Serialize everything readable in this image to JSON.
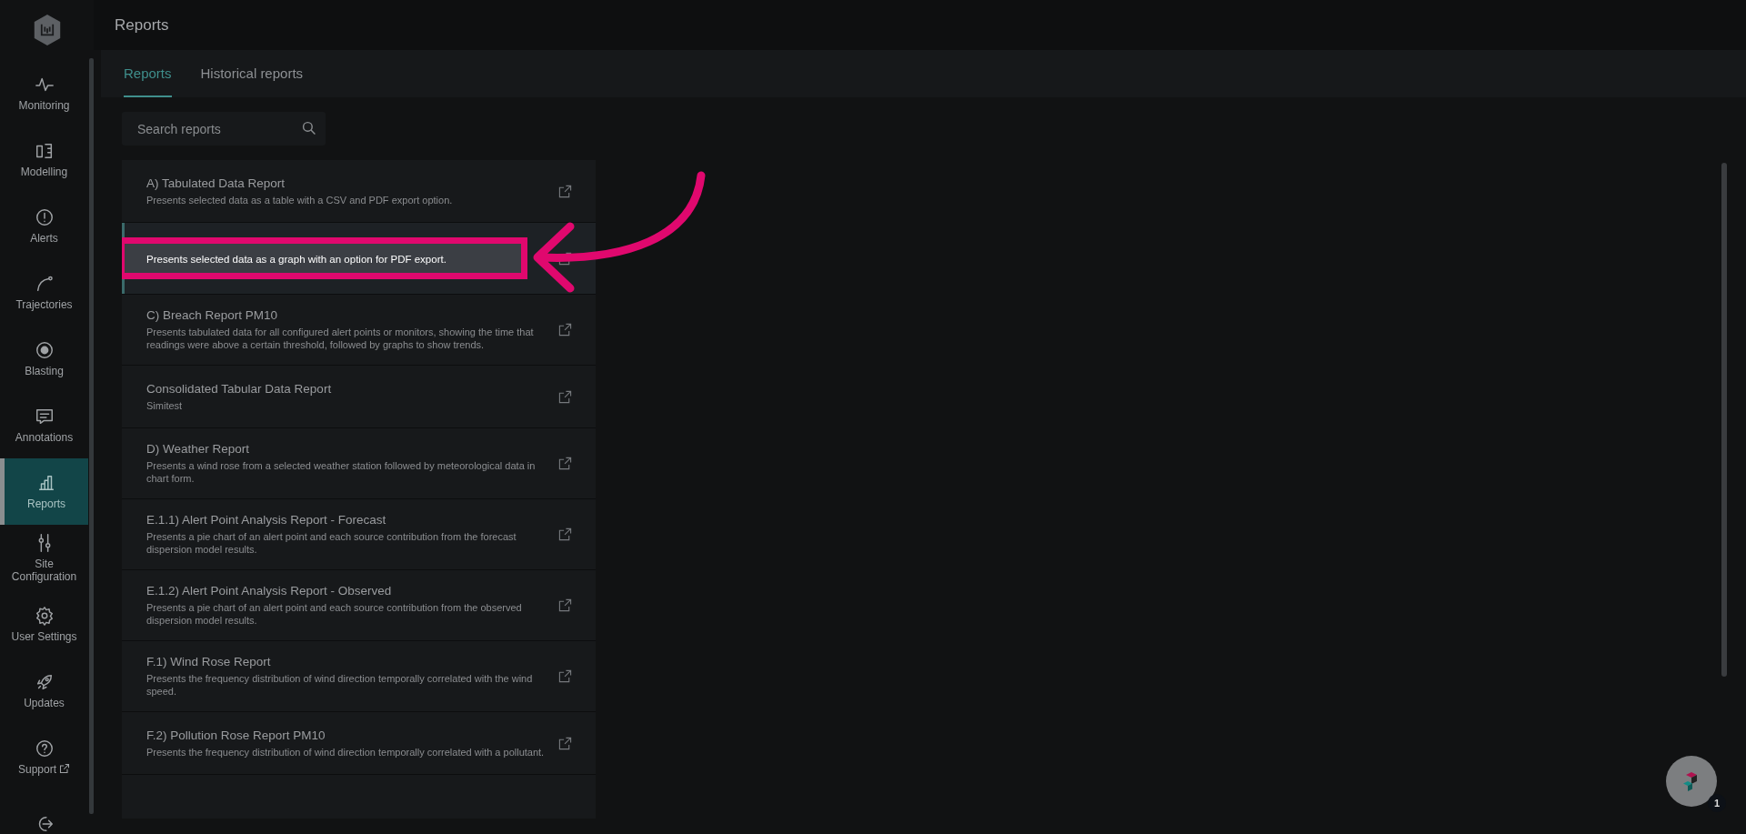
{
  "page": {
    "title": "Reports"
  },
  "sidebar": {
    "items": [
      {
        "label": "Monitoring",
        "external": false,
        "selected": false
      },
      {
        "label": "Modelling",
        "external": false,
        "selected": false
      },
      {
        "label": "Alerts",
        "external": false,
        "selected": false
      },
      {
        "label": "Trajectories",
        "external": false,
        "selected": false
      },
      {
        "label": "Blasting",
        "external": false,
        "selected": false
      },
      {
        "label": "Annotations",
        "external": false,
        "selected": false
      },
      {
        "label": "Reports",
        "external": false,
        "selected": true
      },
      {
        "label": "Site Configuration",
        "external": false,
        "selected": false
      },
      {
        "label": "User Settings",
        "external": false,
        "selected": false
      },
      {
        "label": "Updates",
        "external": false,
        "selected": false
      },
      {
        "label": "Support",
        "external": true,
        "selected": false
      },
      {
        "external": false,
        "selected": false
      }
    ]
  },
  "tabs": [
    {
      "label": "Reports",
      "selected": true
    },
    {
      "label": "Historical reports",
      "selected": false
    }
  ],
  "search": {
    "placeholder": "Search reports"
  },
  "reports": [
    {
      "title": "A) Tabulated Data Report",
      "description": "Presents selected data as a table with a CSV and PDF export option.",
      "selected": false,
      "highlighted": false
    },
    {
      "description": "Presents selected data as a graph with an option for PDF export.",
      "selected": true,
      "highlighted": true
    },
    {
      "title": "C) Breach Report PM10",
      "description": "Presents tabulated data for all configured alert points or monitors, showing the time that readings were above a certain threshold, followed by graphs to show trends.",
      "selected": false,
      "highlighted": false
    },
    {
      "title": "Consolidated Tabular Data Report",
      "description": "Simitest",
      "selected": false,
      "highlighted": false
    },
    {
      "title": "D) Weather Report",
      "description": "Presents a wind rose from a selected weather station followed by meteorological data in chart form.",
      "selected": false,
      "highlighted": false
    },
    {
      "title": "E.1.1) Alert Point Analysis Report - Forecast",
      "description": "Presents a pie chart of an alert point and each source contribution from the forecast dispersion model results.",
      "selected": false,
      "highlighted": false
    },
    {
      "title": "E.1.2) Alert Point Analysis Report - Observed",
      "description": "Presents a pie chart of an alert point and each source contribution from the observed dispersion model results.",
      "selected": false,
      "highlighted": false
    },
    {
      "title": "F.1) Wind Rose Report",
      "description": "Presents the frequency distribution of wind direction temporally correlated with the wind speed.",
      "selected": false,
      "highlighted": false
    },
    {
      "title": "F.2) Pollution Rose Report PM10",
      "description": "Presents the frequency distribution of wind direction temporally correlated with a pollutant.",
      "selected": false,
      "highlighted": false
    },
    {
      "selected": false,
      "highlighted": false
    }
  ],
  "help_widget": {
    "badge": "1"
  }
}
